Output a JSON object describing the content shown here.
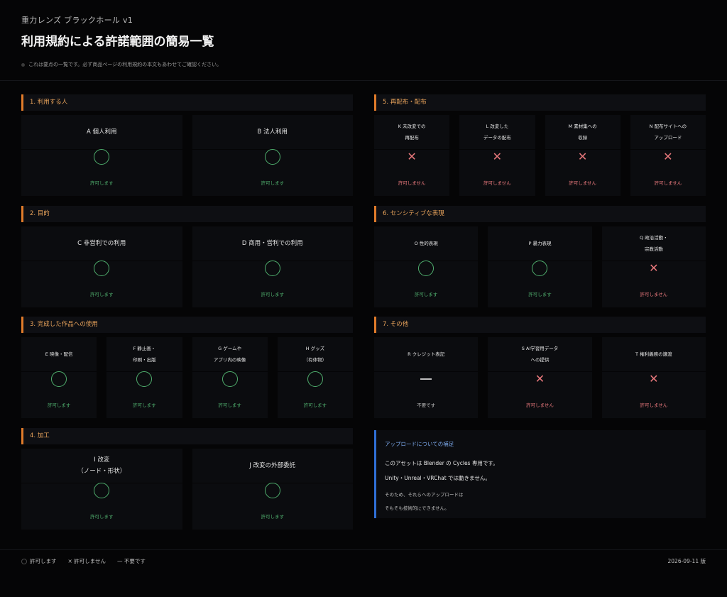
{
  "header": {
    "product": "重力レンズ ブラックホール v1",
    "title": "利用規約による許諾範囲の簡易一覧",
    "note": "これは要点の一覧です。必ず商品ページの利用規約の本文もあわせてご確認ください。"
  },
  "sections": [
    {
      "heading": "1. 利用する人",
      "items": [
        {
          "label": "A 個人利用",
          "status": "許可します"
        },
        {
          "label": "B 法人利用",
          "status": "許可します"
        }
      ]
    },
    {
      "heading": "2. 目的",
      "items": [
        {
          "label": "C 非営利での利用",
          "status": "許可します"
        },
        {
          "label": "D 商用・営利での利用",
          "status": "許可します"
        }
      ]
    },
    {
      "heading": "3. 完成した作品への使用",
      "items": [
        {
          "label": "E 映像・配信",
          "status": "許可します"
        },
        {
          "label": "F 静止画・\n印刷・出版",
          "status": "許可します"
        },
        {
          "label": "G ゲームや\nアプリ内の映像",
          "status": "許可します"
        },
        {
          "label": "H グッズ\n（有体物）",
          "status": "許可します"
        }
      ]
    },
    {
      "heading": "4. 加工",
      "items": [
        {
          "label": "I 改変\n（ノード・形状）",
          "status": "許可します"
        },
        {
          "label": "J 改変の外部委託",
          "status": "許可します"
        }
      ]
    },
    {
      "heading": "5. 再配布・配布",
      "items": [
        {
          "label": "K 未改変での\n再配布",
          "status": "許可しません"
        },
        {
          "label": "L 改変した\nデータの配布",
          "status": "許可しません"
        },
        {
          "label": "M 素材集への\n収録",
          "status": "許可しません"
        },
        {
          "label": "N 配布サイトへの\nアップロード",
          "status": "許可しません"
        }
      ]
    },
    {
      "heading": "6. センシティブな表現",
      "items": [
        {
          "label": "O 性的表現",
          "status": "許可します"
        },
        {
          "label": "P 暴力表現",
          "status": "許可します"
        },
        {
          "label": "Q 政治活動・\n宗教活動",
          "status": "許可しません"
        }
      ]
    },
    {
      "heading": "7. その他",
      "items": [
        {
          "label": "R クレジット表記",
          "status": "不要です"
        },
        {
          "label": "S AI学習用データ\nへの提供",
          "status": "許可しません"
        },
        {
          "label": "T 権利義務の譲渡",
          "status": "許可しません"
        }
      ]
    }
  ],
  "supplement": {
    "title": "アップロードについての補足",
    "line1": "このアセットは Blender の Cycles 専用です。",
    "line2": "Unity・Unreal・VRChat では動きません。",
    "line3": "そのため、それらへのアップロードは",
    "line4": "そもそも技術的にできません。"
  },
  "legend": {
    "ok": "許可します",
    "no": "× 許可しません",
    "na": "— 不要です"
  },
  "version": "2026-09-11 版",
  "colors": {
    "accent_orange": "#e07b2a",
    "allowed_green": "#4fae6d",
    "denied_red": "#e8787c",
    "info_blue": "#2f6fd6"
  }
}
